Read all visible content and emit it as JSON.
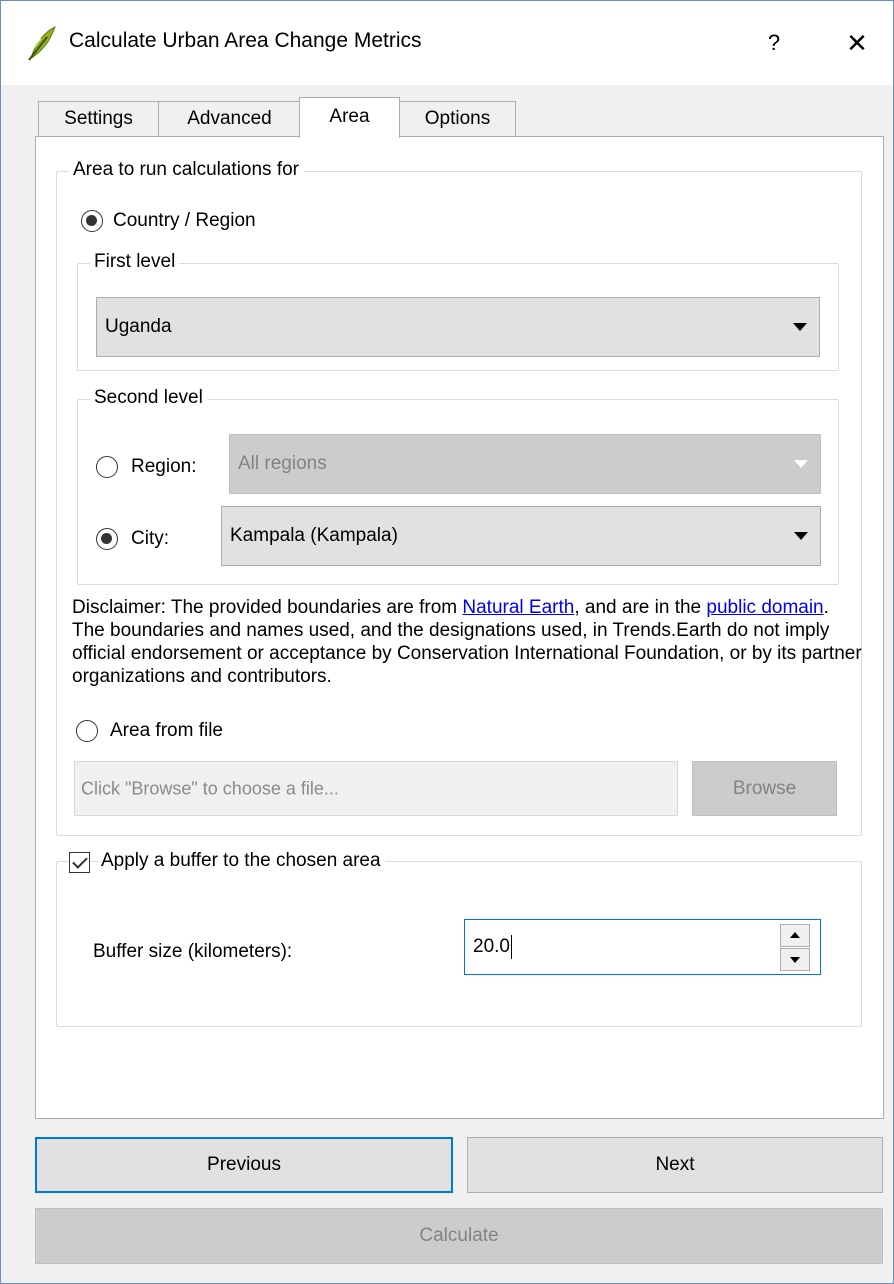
{
  "window": {
    "title": "Calculate Urban Area Change Metrics",
    "help_label": "?",
    "close_label": "✕"
  },
  "tabs": [
    {
      "label": "Settings"
    },
    {
      "label": "Advanced"
    },
    {
      "label": "Area",
      "active": true
    },
    {
      "label": "Options"
    }
  ],
  "area_group": {
    "title": "Area to run calculations for",
    "country_region_label": "Country / Region",
    "first_level": {
      "title": "First level",
      "selected": "Uganda"
    },
    "second_level": {
      "title": "Second level",
      "region_label": "Region:",
      "region_selected": "All regions",
      "city_label": "City:",
      "city_selected": "Kampala (Kampala)"
    },
    "disclaimer": {
      "part1": "Disclaimer: The provided boundaries are from ",
      "link1": "Natural Earth",
      "part2": ", and are in the ",
      "link2": "public domain",
      "part3": ". The boundaries and names used, and the designations used, in Trends.Earth do not imply official endorsement or acceptance by Conservation International Foundation, or by its partner organizations and contributors."
    },
    "area_from_file_label": "Area from file",
    "file_placeholder": "Click \"Browse\" to choose a file...",
    "browse_label": "Browse"
  },
  "buffer_group": {
    "checkbox_label": "Apply a buffer to the chosen area",
    "checked": true,
    "size_label": "Buffer size (kilometers):",
    "size_value": "20.0"
  },
  "footer": {
    "previous_label": "Previous",
    "next_label": "Next",
    "calculate_label": "Calculate"
  },
  "colors": {
    "accent": "#0078d7",
    "link": "#0000ee",
    "window_bg": "#f0f0f0",
    "disabled_bg": "#cccccc"
  }
}
